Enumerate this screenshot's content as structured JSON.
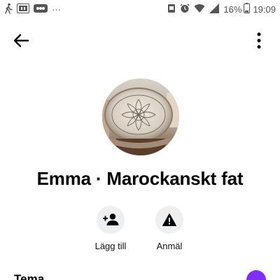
{
  "status_bar": {
    "left_icons": [
      "walking-icon",
      "sim-icon",
      "notification-icon"
    ],
    "more_dots": "···",
    "right_icons": [
      "screenshot-icon",
      "alarm-icon",
      "wifi-icon",
      "signal-icon"
    ],
    "battery": "16%",
    "time": "19:09"
  },
  "header": {
    "back_icon": "arrow-left-icon",
    "more_icon": "vertical-dots-icon"
  },
  "profile": {
    "title": "Emma · Marockanskt fat"
  },
  "actions": [
    {
      "label": "Lägg till",
      "icon": "add-person-icon"
    },
    {
      "label": "Anmäl",
      "icon": "warning-icon"
    }
  ],
  "section": {
    "label": "Tema"
  },
  "colors": {
    "accent": "#7f2ff7",
    "action_bg": "#eeeff1"
  }
}
